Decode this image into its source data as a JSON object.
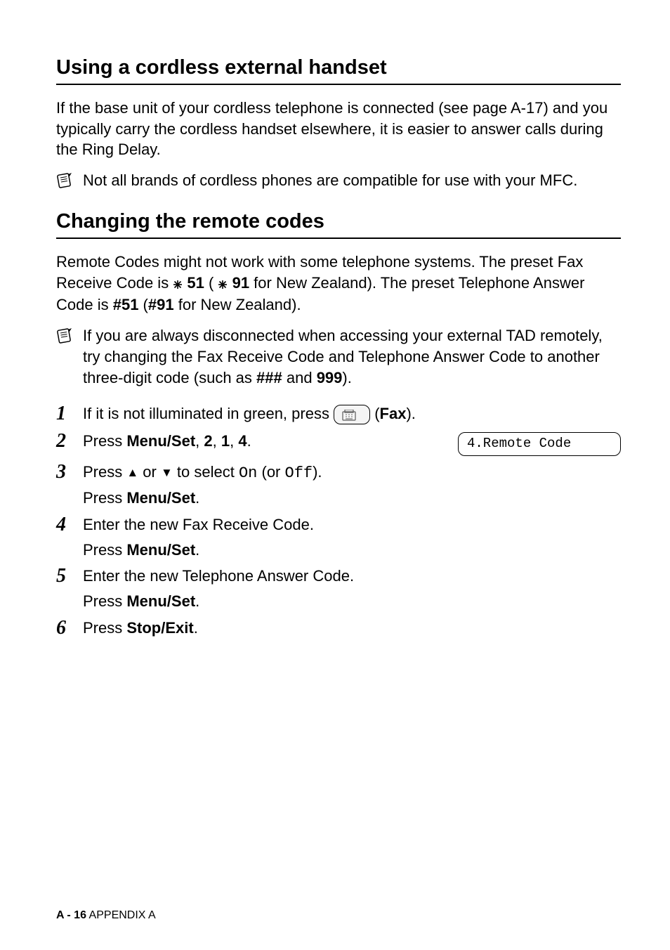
{
  "section1": {
    "heading": "Using a cordless external handset",
    "para": "If the base unit of your cordless telephone is connected (see page A-17) and you typically carry the cordless handset elsewhere, it is easier to answer calls during the Ring Delay.",
    "note": "Not all brands of cordless phones are compatible for use with your MFC."
  },
  "section2": {
    "heading": "Changing the remote codes",
    "para_parts": {
      "p1": "Remote Codes might not work with some telephone systems. The preset Fax Receive Code is ",
      "code1a": " 51",
      "paren1": " ( ",
      "code1b": " 91",
      "p2": " for New Zealand). The preset Telephone Answer Code is ",
      "code2a": "#51",
      "paren2": " (",
      "code2b": "#91",
      "p3": " for New Zealand)."
    },
    "note_parts": {
      "n1": "If you are always disconnected when accessing your external TAD remotely, try changing the Fax Receive Code and Telephone Answer Code to another three-digit code (such as ",
      "c1": "###",
      "n2": " and ",
      "c2": "999",
      "n3": ")."
    }
  },
  "steps": {
    "s1": {
      "num": "1",
      "t1": "If it is not illuminated in green, press ",
      "fax": "Fax",
      "t2": ")."
    },
    "s2": {
      "num": "2",
      "t1": "Press ",
      "b1": "Menu/Set",
      "t2": ", ",
      "b2": "2",
      "t3": ", ",
      "b3": "1",
      "t4": ", ",
      "b4": "4",
      "t5": ".",
      "lcd": "4.Remote Code"
    },
    "s3": {
      "num": "3",
      "t1": "Press ",
      "t2": " or ",
      "t3": " to select ",
      "on": "On",
      "t4": " (or ",
      "off": "Off",
      "t5": ").",
      "sub_t1": "Press ",
      "sub_b1": "Menu/Set",
      "sub_t2": "."
    },
    "s4": {
      "num": "4",
      "t1": "Enter the new Fax Receive Code.",
      "sub_t1": "Press ",
      "sub_b1": "Menu/Set",
      "sub_t2": "."
    },
    "s5": {
      "num": "5",
      "t1": "Enter the new Telephone Answer Code.",
      "sub_t1": "Press ",
      "sub_b1": "Menu/Set",
      "sub_t2": "."
    },
    "s6": {
      "num": "6",
      "t1": "Press ",
      "b1": "Stop/Exit",
      "t2": "."
    }
  },
  "footer": {
    "page": "A - 16",
    "label": "   APPENDIX A"
  }
}
